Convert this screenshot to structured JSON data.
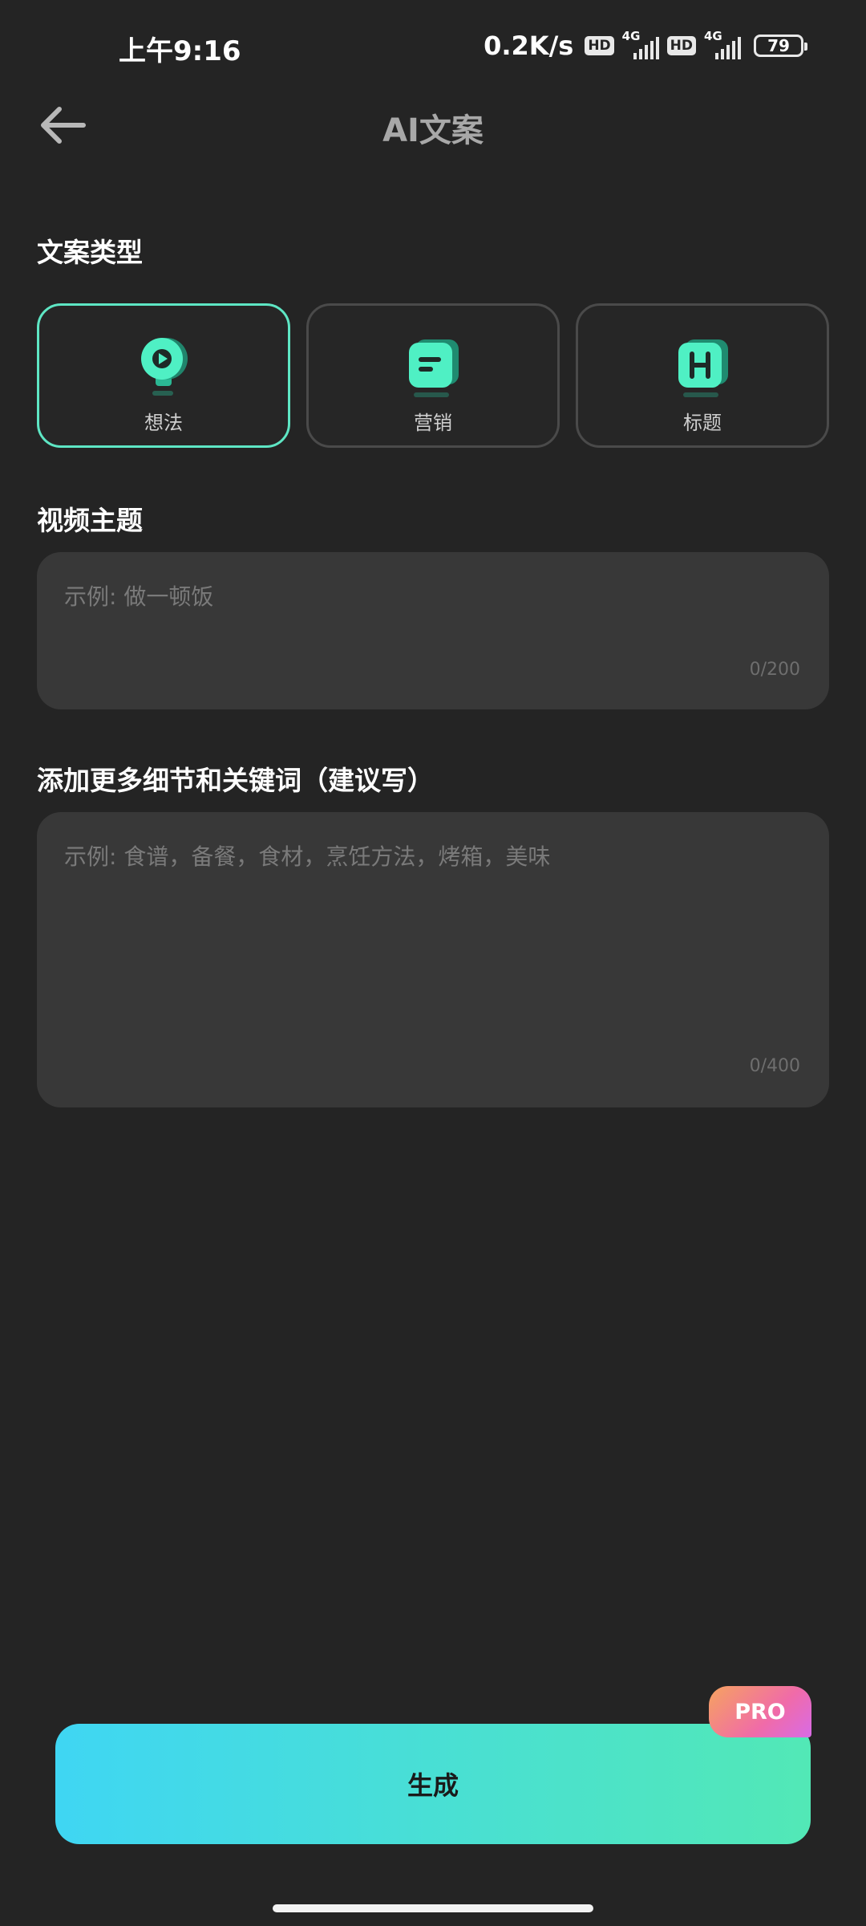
{
  "status_bar": {
    "time": "上午9:16",
    "net_speed": "0.2K/s",
    "hd_1": "HD",
    "gen_1": "4G",
    "hd_2": "HD",
    "gen_2": "4G",
    "battery": "79"
  },
  "header": {
    "title": "AI文案",
    "back_icon": "arrow-left-icon"
  },
  "type_section": {
    "label": "文案类型",
    "options": [
      {
        "label": "想法",
        "icon": "idea-play-icon",
        "selected": true
      },
      {
        "label": "营销",
        "icon": "marketing-note-icon",
        "selected": false
      },
      {
        "label": "标题",
        "icon": "heading-h-icon",
        "selected": false
      }
    ]
  },
  "topic_section": {
    "label": "视频主题",
    "placeholder": "示例: 做一顿饭",
    "value": "",
    "counter": "0/200"
  },
  "details_section": {
    "label": "添加更多细节和关键词（建议写）",
    "placeholder": "示例: 食谱，备餐，食材，烹饪方法，烤箱，美味",
    "value": "",
    "counter": "0/400"
  },
  "generate": {
    "label": "生成",
    "badge": "PRO"
  },
  "colors": {
    "background": "#242424",
    "accent": "#5ee6c4",
    "button_gradient_start": "#3fd6f3",
    "button_gradient_end": "#52e8b6",
    "pro_gradient": "#f06ba8"
  }
}
